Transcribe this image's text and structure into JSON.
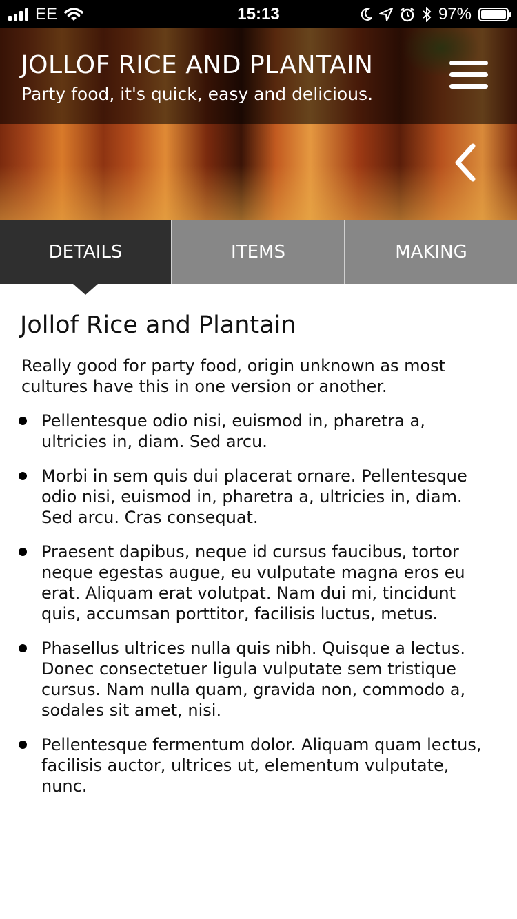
{
  "status_bar": {
    "carrier": "EE",
    "time": "15:13",
    "battery": "97%"
  },
  "header": {
    "title": "JOLLOF RICE AND PLANTAIN",
    "subtitle": "Party food, it's quick, easy and delicious."
  },
  "tabs": [
    {
      "label": "DETAILS",
      "active": true
    },
    {
      "label": "ITEMS",
      "active": false
    },
    {
      "label": "MAKING",
      "active": false
    }
  ],
  "details": {
    "heading": "Jollof Rice and Plantain",
    "intro": "Really good for party food, origin unknown as most cultures have this in one version or another.",
    "bullets": [
      "Pellentesque odio nisi, euismod in, pharetra a, ultricies in, diam. Sed arcu.",
      "Morbi in sem quis dui placerat ornare. Pellentesque odio nisi, euismod in, pharetra a, ultricies in, diam. Sed arcu. Cras consequat.",
      "Praesent dapibus, neque id cursus faucibus, tortor neque egestas augue, eu vulputate magna eros eu erat. Aliquam erat volutpat. Nam dui mi, tincidunt quis, accumsan porttitor, facilisis luctus, metus.",
      "Phasellus ultrices nulla quis nibh. Quisque a lectus. Donec consectetuer ligula vulputate sem tristique cursus. Nam nulla quam, gravida non, commodo a, sodales sit amet, nisi.",
      "Pellentesque fermentum dolor. Aliquam quam lectus, facilisis auctor, ultrices ut, elementum vulputate, nunc."
    ]
  },
  "colors": {
    "tab_active": "#2f2f2f",
    "tab_inactive": "#878787",
    "status_bar": "#000000"
  },
  "icons": [
    "signal-icon",
    "wifi-icon",
    "moon-icon",
    "location-icon",
    "alarm-icon",
    "bluetooth-icon",
    "battery-icon",
    "menu-icon",
    "chevron-left-icon"
  ]
}
